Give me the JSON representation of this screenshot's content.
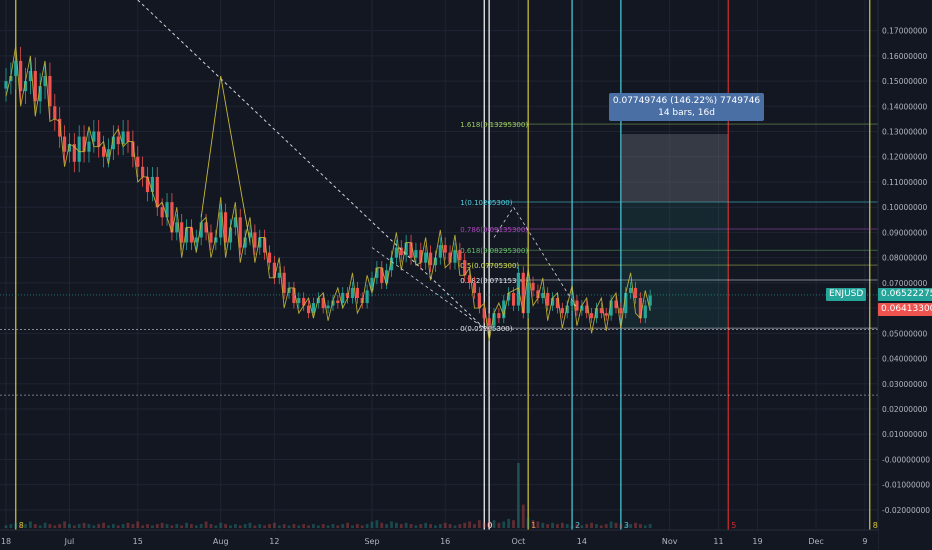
{
  "symbol": "ENJUSD",
  "last_price_label": "0.06522275",
  "prev_close_label": "0.06413300",
  "colors": {
    "background": "#131722",
    "grid": "#1f2433",
    "up": "#26a69a",
    "down": "#ef5350",
    "axis_text": "#b2b5be",
    "yellow": "#d6c73a",
    "cyan": "#4dd0e1",
    "red": "#d32f2f",
    "white": "#e0e3eb"
  },
  "measure": {
    "line1": "0.07749746 (146.22%) 7749746",
    "line2": "14 bars, 16d"
  },
  "chart_data": {
    "type": "candlestick",
    "ylim": [
      -0.024,
      0.175
    ],
    "y_ticks": [
      "0.17000000",
      "0.16000000",
      "0.15000000",
      "0.14000000",
      "0.13000000",
      "0.12000000",
      "0.11000000",
      "0.10000000",
      "0.09000000",
      "0.08000000",
      "0.07000000",
      "0.06000000",
      "0.05000000",
      "0.04000000",
      "0.03000000",
      "0.02000000",
      "0.01000000",
      "-0.00000000",
      "-0.01000000",
      "-0.02000000"
    ],
    "y_tick_values": [
      0.17,
      0.16,
      0.15,
      0.14,
      0.13,
      0.12,
      0.11,
      0.1,
      0.09,
      0.08,
      0.07,
      0.06,
      0.05,
      0.04,
      0.03,
      0.02,
      0.01,
      0.0,
      -0.01,
      -0.02
    ],
    "x_ticks": [
      {
        "label": "18",
        "day": 0
      },
      {
        "label": "Jul",
        "day": 13
      },
      {
        "label": "15",
        "day": 27
      },
      {
        "label": "Aug",
        "day": 44
      },
      {
        "label": "12",
        "day": 55
      },
      {
        "label": "Sep",
        "day": 75
      },
      {
        "label": "16",
        "day": 90
      },
      {
        "label": "Oct",
        "day": 105
      },
      {
        "label": "14",
        "day": 118
      },
      {
        "label": "Nov",
        "day": 136
      },
      {
        "label": "11",
        "day": 146
      },
      {
        "label": "19",
        "day": 154
      },
      {
        "label": "Dec",
        "day": 166
      },
      {
        "label": "9",
        "day": 176
      }
    ],
    "fib_levels": [
      {
        "label": "1.618(0.13295300)",
        "value": 0.132953,
        "color": "#9ccc65"
      },
      {
        "label": "1(0.10205300)",
        "value": 0.102053,
        "color": "#4dd0e1"
      },
      {
        "label": "0.786(0.09135300)",
        "value": 0.091353,
        "color": "#ab47bc"
      },
      {
        "label": "0.618(0.08295300)",
        "value": 0.082953,
        "color": "#66bb6a"
      },
      {
        "label": "0.5(0.07705300)",
        "value": 0.077053,
        "color": "#d4e157"
      },
      {
        "label": "0.382(0.07115300)",
        "value": 0.071153,
        "color": "#e0e3eb"
      },
      {
        "label": "0(0.05205300)",
        "value": 0.052053,
        "color": "#e0e3eb"
      }
    ],
    "vertical_markers": [
      {
        "day": 2,
        "color": "#d6c73a",
        "label": "8"
      },
      {
        "day": 98,
        "color": "#ffffff",
        "label": "0"
      },
      {
        "day": 99,
        "color": "#ffffff",
        "label": ""
      },
      {
        "day": 107,
        "color": "#d6c73a",
        "label": "1"
      },
      {
        "day": 116,
        "color": "#4dd0e1",
        "label": "2"
      },
      {
        "day": 126,
        "color": "#4dd0e1",
        "label": "3"
      },
      {
        "day": 148,
        "color": "#d32f2f",
        "label": "5"
      },
      {
        "day": 177,
        "color": "#d6c73a",
        "label": "8"
      }
    ],
    "closes": [
      0.15,
      0.152,
      0.158,
      0.146,
      0.15,
      0.154,
      0.142,
      0.148,
      0.152,
      0.14,
      0.135,
      0.128,
      0.122,
      0.125,
      0.118,
      0.128,
      0.122,
      0.126,
      0.13,
      0.124,
      0.12,
      0.123,
      0.128,
      0.125,
      0.13,
      0.126,
      0.12,
      0.116,
      0.112,
      0.106,
      0.112,
      0.1,
      0.096,
      0.102,
      0.09,
      0.094,
      0.086,
      0.092,
      0.086,
      0.088,
      0.094,
      0.09,
      0.086,
      0.088,
      0.098,
      0.086,
      0.092,
      0.096,
      0.084,
      0.088,
      0.09,
      0.084,
      0.088,
      0.082,
      0.078,
      0.072,
      0.074,
      0.066,
      0.068,
      0.062,
      0.064,
      0.061,
      0.058,
      0.062,
      0.064,
      0.06,
      0.061,
      0.063,
      0.062,
      0.066,
      0.064,
      0.068,
      0.064,
      0.062,
      0.067,
      0.072,
      0.076,
      0.07,
      0.075,
      0.08,
      0.084,
      0.081,
      0.086,
      0.08,
      0.083,
      0.078,
      0.082,
      0.077,
      0.08,
      0.085,
      0.082,
      0.078,
      0.083,
      0.079,
      0.073,
      0.07,
      0.066,
      0.06,
      0.056,
      0.053,
      0.058,
      0.056,
      0.063,
      0.066,
      0.061,
      0.074,
      0.058,
      0.07,
      0.067,
      0.064,
      0.066,
      0.061,
      0.064,
      0.06,
      0.058,
      0.061,
      0.063,
      0.059,
      0.061,
      0.058,
      0.056,
      0.06,
      0.058,
      0.057,
      0.063,
      0.06,
      0.058,
      0.066,
      0.068,
      0.064,
      0.056,
      0.061,
      0.065
    ],
    "volumes": [
      0.2,
      0.3,
      0.4,
      0.2,
      0.3,
      0.5,
      0.3,
      0.2,
      0.4,
      0.3,
      0.2,
      0.3,
      0.5,
      0.3,
      0.2,
      0.3,
      0.4,
      0.3,
      0.2,
      0.3,
      0.4,
      0.2,
      0.3,
      0.2,
      0.3,
      0.4,
      0.3,
      0.5,
      0.2,
      0.3,
      0.2,
      0.3,
      0.4,
      0.3,
      0.2,
      0.3,
      0.2,
      0.4,
      0.3,
      0.2,
      0.3,
      0.5,
      0.3,
      0.2,
      0.4,
      0.3,
      0.2,
      0.3,
      0.2,
      0.3,
      0.4,
      0.2,
      0.3,
      0.2,
      0.3,
      0.4,
      0.2,
      0.3,
      0.2,
      0.3,
      0.2,
      0.3,
      0.2,
      0.3,
      0.2,
      0.3,
      0.2,
      0.3,
      0.2,
      0.3,
      0.4,
      0.2,
      0.3,
      0.2,
      0.3,
      0.5,
      0.6,
      0.4,
      0.3,
      0.5,
      0.4,
      0.3,
      0.4,
      0.3,
      0.2,
      0.3,
      0.4,
      0.3,
      0.2,
      0.3,
      0.4,
      0.3,
      0.2,
      0.3,
      0.4,
      0.5,
      0.3,
      0.6,
      0.4,
      0.5,
      0.6,
      0.4,
      0.5,
      0.7,
      0.6,
      5.0,
      1.8,
      0.8,
      0.6,
      0.5,
      0.4,
      0.3,
      0.4,
      0.3,
      0.4,
      0.3,
      0.2,
      0.3,
      0.2,
      0.3,
      0.4,
      0.3,
      0.2,
      0.3,
      0.5,
      0.4,
      0.3,
      0.2,
      0.3,
      0.4,
      0.3,
      0.2,
      0.3
    ]
  }
}
